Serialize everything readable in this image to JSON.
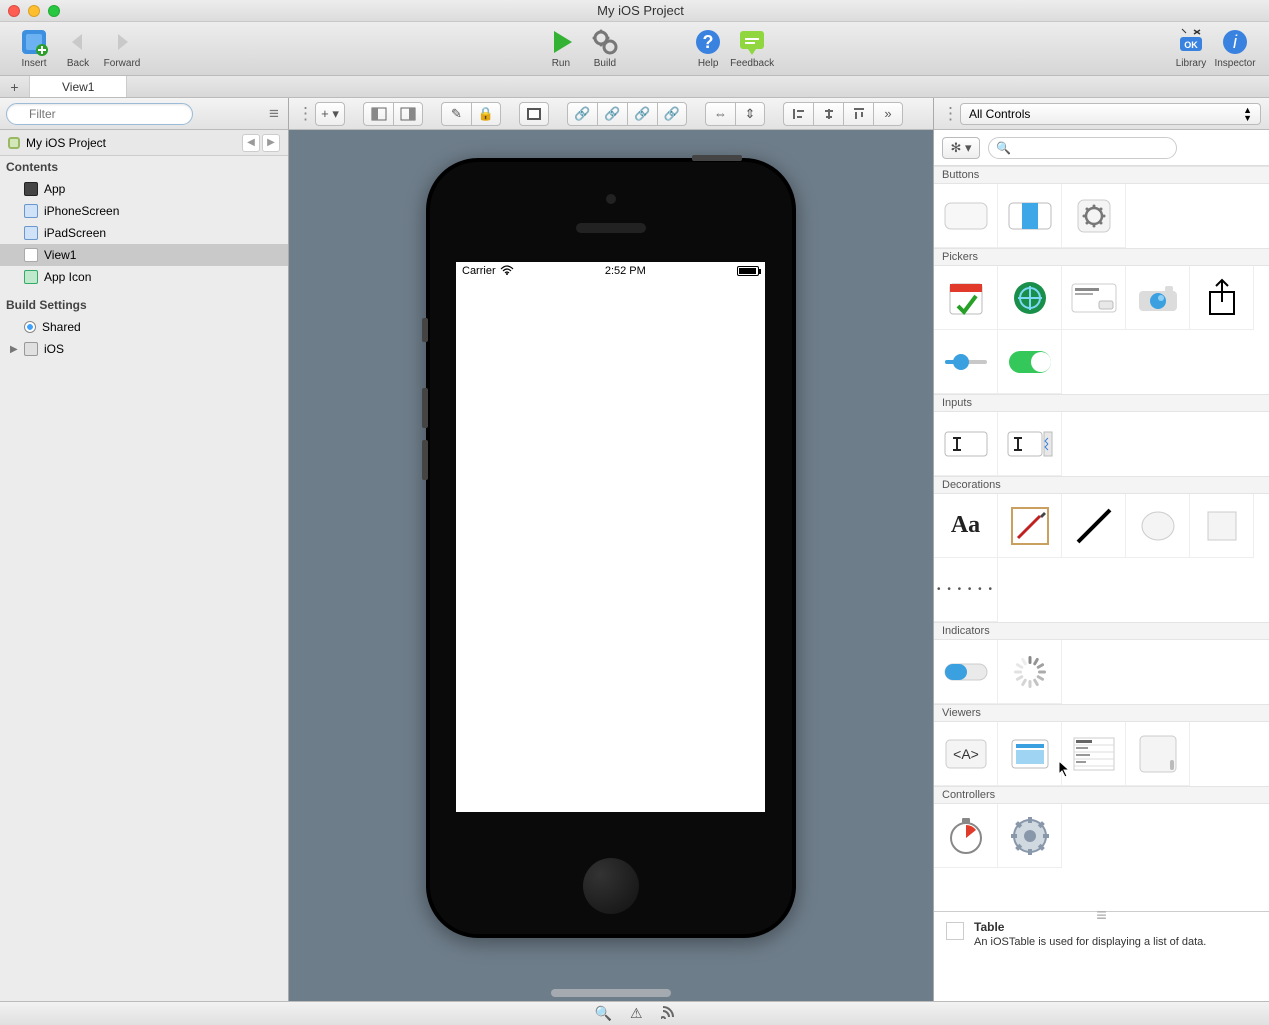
{
  "window": {
    "title": "My iOS Project"
  },
  "toolbar": {
    "insert": "Insert",
    "back": "Back",
    "forward": "Forward",
    "run": "Run",
    "build": "Build",
    "help": "Help",
    "feedback": "Feedback",
    "library": "Library",
    "inspector": "Inspector"
  },
  "tabs": {
    "active": "View1"
  },
  "sidebar": {
    "filter_placeholder": "Filter",
    "project": "My iOS Project",
    "contents_h": "Contents",
    "items": [
      {
        "label": "App"
      },
      {
        "label": "iPhoneScreen"
      },
      {
        "label": "iPadScreen"
      },
      {
        "label": "View1"
      },
      {
        "label": "App Icon"
      }
    ],
    "build_h": "Build Settings",
    "build": [
      {
        "label": "Shared"
      },
      {
        "label": "iOS"
      }
    ]
  },
  "device": {
    "carrier": "Carrier",
    "time": "2:52 PM"
  },
  "library": {
    "filter": "All Controls",
    "sections": {
      "buttons": "Buttons",
      "pickers": "Pickers",
      "inputs": "Inputs",
      "decorations": "Decorations",
      "indicators": "Indicators",
      "viewers": "Viewers",
      "controllers": "Controllers"
    },
    "detail": {
      "title": "Table",
      "desc": "An iOSTable is used for displaying a list of data."
    }
  }
}
